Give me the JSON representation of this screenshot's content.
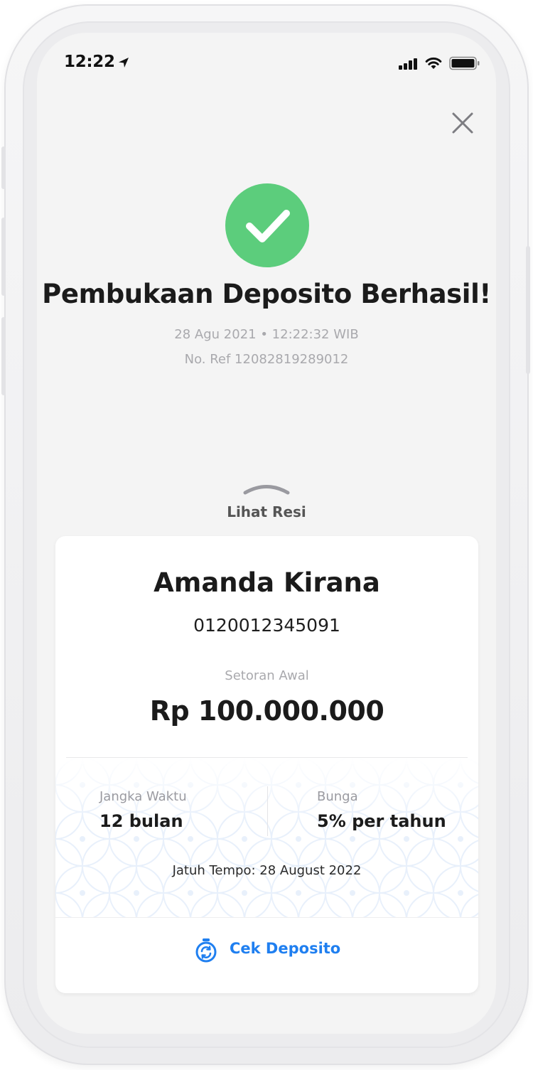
{
  "status_bar": {
    "time": "12:22"
  },
  "header": {
    "title": "Pembukaan Deposito Berhasil!",
    "datetime": "28 Agu 2021 • 12:22:32 WIB",
    "reference": "No. Ref 12082819289012"
  },
  "receipt_toggle": {
    "label": "Lihat Resi"
  },
  "receipt": {
    "customer_name": "Amanda Kirana",
    "account_number": "0120012345091",
    "deposit_label": "Setoran Awal",
    "deposit_amount": "Rp 100.000.000",
    "term_label": "Jangka Waktu",
    "term_value": "12 bulan",
    "interest_label": "Bunga",
    "interest_value": "5% per tahun",
    "maturity": "Jatuh Tempo: 28 August 2022"
  },
  "actions": {
    "check_deposit": "Cek Deposito"
  },
  "colors": {
    "success": "#5ccd7c",
    "accent": "#1f7ff0",
    "screen_bg": "#f4f4f4"
  },
  "icons": {
    "status": [
      "location-arrow-icon",
      "signal-icon",
      "wifi-icon",
      "battery-icon"
    ],
    "close": "close-icon",
    "success": "checkmark-icon",
    "toggle": "chevron-up-icon",
    "action": "deposit-clock-icon"
  }
}
